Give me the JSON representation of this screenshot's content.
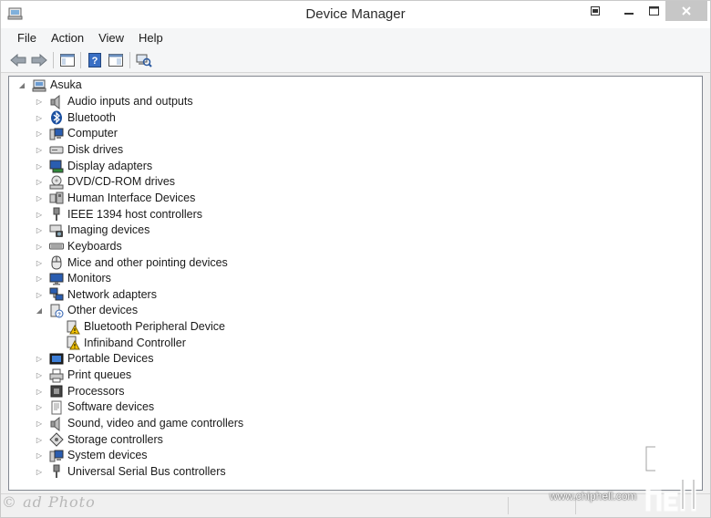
{
  "window": {
    "title": "Device Manager"
  },
  "menu": [
    "File",
    "Action",
    "View",
    "Help"
  ],
  "toolbar": {
    "buttons": [
      "back-arrow-icon",
      "forward-arrow-icon",
      "show-hide-console-tree-icon",
      "help-icon",
      "properties-icon",
      "scan-hardware-icon"
    ]
  },
  "tree": {
    "root": {
      "label": "Asuka",
      "icon": "computer-root-icon"
    },
    "categories": [
      {
        "label": "Audio inputs and outputs",
        "icon": "speaker-icon",
        "expanded": false
      },
      {
        "label": "Bluetooth",
        "icon": "bluetooth-icon",
        "expanded": false
      },
      {
        "label": "Computer",
        "icon": "computer-icon",
        "expanded": false
      },
      {
        "label": "Disk drives",
        "icon": "disk-drive-icon",
        "expanded": false
      },
      {
        "label": "Display adapters",
        "icon": "display-adapter-icon",
        "expanded": false
      },
      {
        "label": "DVD/CD-ROM drives",
        "icon": "dvd-drive-icon",
        "expanded": false
      },
      {
        "label": "Human Interface Devices",
        "icon": "hid-icon",
        "expanded": false
      },
      {
        "label": "IEEE 1394 host controllers",
        "icon": "firewire-icon",
        "expanded": false
      },
      {
        "label": "Imaging devices",
        "icon": "camera-icon",
        "expanded": false
      },
      {
        "label": "Keyboards",
        "icon": "keyboard-icon",
        "expanded": false
      },
      {
        "label": "Mice and other pointing devices",
        "icon": "mouse-icon",
        "expanded": false
      },
      {
        "label": "Monitors",
        "icon": "monitor-icon",
        "expanded": false
      },
      {
        "label": "Network adapters",
        "icon": "network-icon",
        "expanded": false
      },
      {
        "label": "Other devices",
        "icon": "unknown-device-icon",
        "expanded": true,
        "children": [
          {
            "label": "Bluetooth Peripheral Device",
            "icon": "warning-device-icon"
          },
          {
            "label": "Infiniband Controller",
            "icon": "warning-device-icon"
          }
        ]
      },
      {
        "label": "Portable Devices",
        "icon": "portable-device-icon",
        "expanded": false
      },
      {
        "label": "Print queues",
        "icon": "printer-icon",
        "expanded": false
      },
      {
        "label": "Processors",
        "icon": "processor-icon",
        "expanded": false
      },
      {
        "label": "Software devices",
        "icon": "software-device-icon",
        "expanded": false
      },
      {
        "label": "Sound, video and game controllers",
        "icon": "sound-controller-icon",
        "expanded": false
      },
      {
        "label": "Storage controllers",
        "icon": "storage-controller-icon",
        "expanded": false
      },
      {
        "label": "System devices",
        "icon": "system-device-icon",
        "expanded": false
      },
      {
        "label": "Universal Serial Bus controllers",
        "icon": "usb-icon",
        "expanded": false
      }
    ]
  },
  "watermarks": {
    "left": "© ad Photo",
    "url": "www.chiphell.com",
    "logo": "chip hell"
  }
}
